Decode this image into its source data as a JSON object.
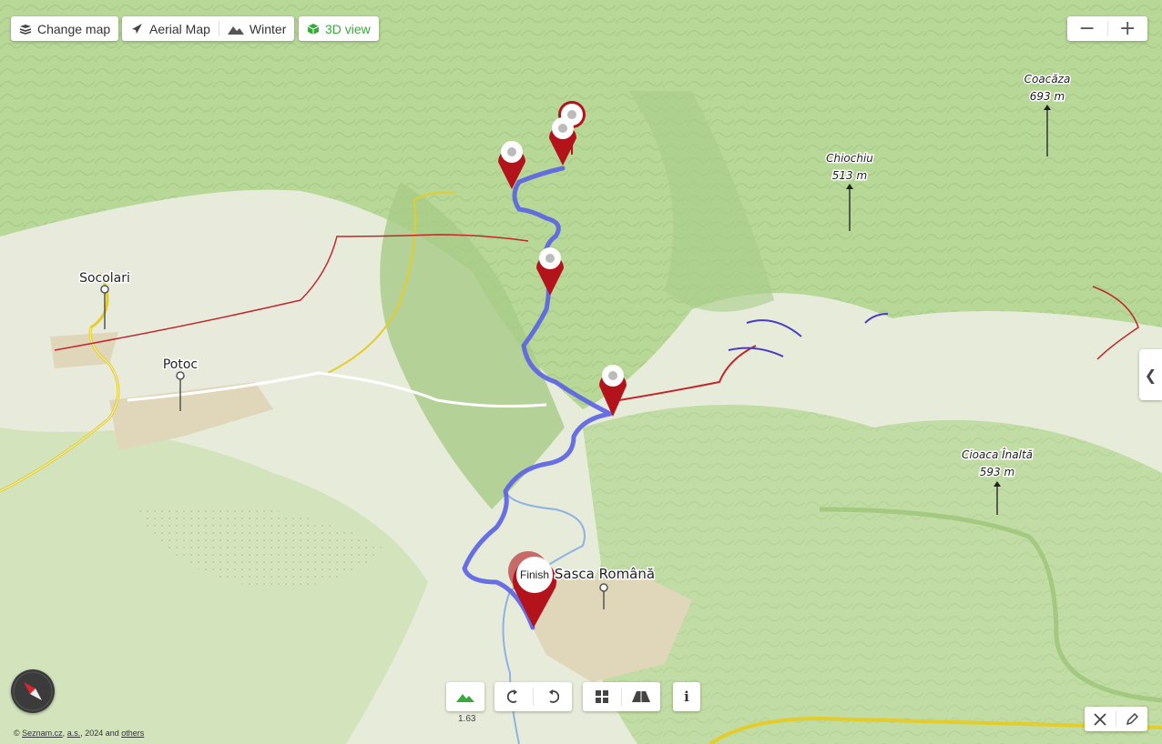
{
  "toolbar": {
    "change_map": "Change map",
    "aerial_map": "Aerial Map",
    "winter": "Winter",
    "view_3d": "3D view"
  },
  "zoom": {
    "minus": "−",
    "plus": "+"
  },
  "panel_toggle": "❮",
  "places": {
    "socolari": "Socolari",
    "potoc": "Potoc",
    "sasca_romana": "Sasca Română"
  },
  "peaks": [
    {
      "name": "Coacăza",
      "elevation": "693 m"
    },
    {
      "name": "Chiochiu",
      "elevation": "513 m"
    },
    {
      "name": "Cioaca Înaltă",
      "elevation": "593 m"
    }
  ],
  "finish_label": "Finish",
  "tilt_level": "1.63",
  "info_label": "i",
  "attribution": {
    "prefix": "© ",
    "seznam": "Seznam.cz",
    "sep": ", ",
    "as": "a.s.",
    "year": ", 2024 and ",
    "others": "others"
  },
  "colors": {
    "route": "#5a62e6",
    "pin": "#b3141c",
    "accent_3d": "#3aa83b",
    "forest": "#b9d99a",
    "meadow": "#e4ead6",
    "village": "#e0d6b9"
  },
  "icons": {
    "layers": "layers-icon",
    "airplane": "airplane-icon",
    "mountain": "mountain-icon",
    "cube": "cube-icon",
    "relief": "relief-icon",
    "rotate_left": "rotate-left-icon",
    "rotate_right": "rotate-right-icon",
    "grid": "grid-icon",
    "perspective": "perspective-icon",
    "measure": "measure-icon",
    "pencil": "pencil-icon",
    "compass": "compass-icon"
  }
}
